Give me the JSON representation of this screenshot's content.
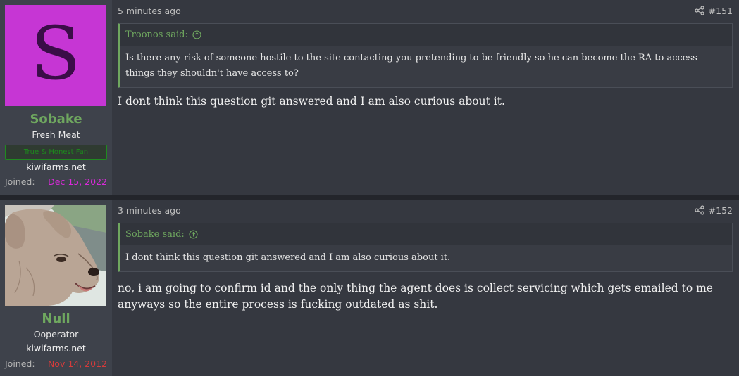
{
  "posts": [
    {
      "author": {
        "name": "Sobake",
        "avatar_letter": "S",
        "avatar_bg": "#c636d4",
        "title": "Fresh Meat",
        "banner": "True & Honest Fan",
        "site": "kiwifarms.net",
        "joined_label": "Joined:",
        "joined_date": "Dec 15, 2022",
        "joined_color": "#d82ad9"
      },
      "time": "5 minutes ago",
      "number": "#151",
      "quote": {
        "header": "Troonos said:",
        "text": "Is there any risk of someone hostile to the site contacting you pretending to be friendly so he can become the RA to access things they shouldn't have access to?"
      },
      "body": "I dont think this question git answered and I am also curious about it."
    },
    {
      "author": {
        "name": "Null",
        "avatar_icon": "dog-avatar",
        "title": "Ooperator",
        "site": "kiwifarms.net",
        "joined_label": "Joined:",
        "joined_date": "Nov 14, 2012",
        "joined_color": "#d43b3b"
      },
      "time": "3 minutes ago",
      "number": "#152",
      "quote": {
        "header": "Sobake said:",
        "text": "I dont think this question git answered and I am also curious about it."
      },
      "body": "no, i am going to confirm id and the only thing the agent does is collect servicing which gets emailed to me anyways so the entire process is fucking outdated as shit."
    }
  ],
  "colors": {
    "accent_green": "#6fa75f",
    "panel": "#353840",
    "user_panel": "#3e424b"
  },
  "icons": {
    "share": "share-icon",
    "quote_jump": "arrow-up-circle-icon"
  }
}
